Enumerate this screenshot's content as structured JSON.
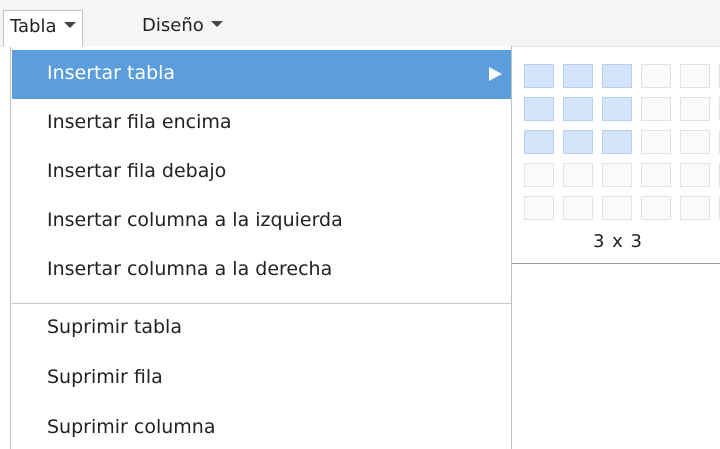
{
  "menubar": {
    "items": [
      {
        "label": "Tabla",
        "active": true
      },
      {
        "label": "Diseño",
        "active": false
      }
    ]
  },
  "dropdown": {
    "items": [
      {
        "label": "Insertar tabla",
        "highlighted": true,
        "has_submenu": true
      },
      {
        "label": "Insertar fila encima"
      },
      {
        "label": "Insertar fila debajo"
      },
      {
        "label": "Insertar columna a la izquierda"
      },
      {
        "label": "Insertar columna a la derecha"
      },
      {
        "separator": true
      },
      {
        "label": "Suprimir tabla"
      },
      {
        "label": "Suprimir fila"
      },
      {
        "label": "Suprimir columna"
      }
    ]
  },
  "grid_picker": {
    "rows_visible": 5,
    "cols_visible": 7,
    "selected_rows": 3,
    "selected_cols": 3,
    "size_label": "3 x 3"
  },
  "colors": {
    "highlight": "#5b9ddd",
    "cell_selected": "#d4e4fb",
    "cell_default": "#fafafa"
  }
}
